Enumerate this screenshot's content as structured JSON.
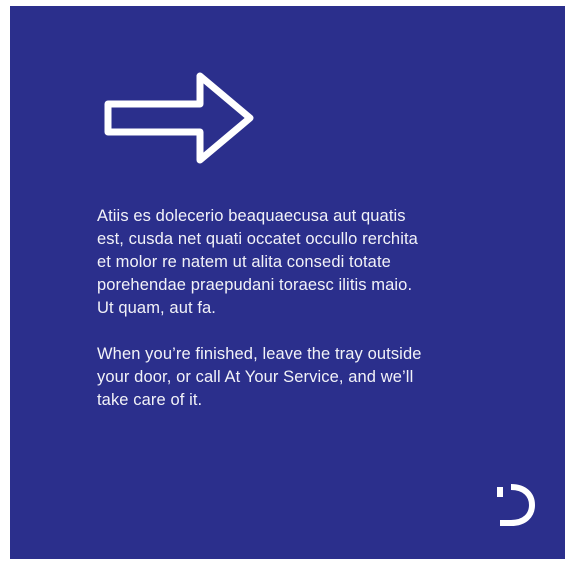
{
  "card": {
    "background_color": "#2b2f8c",
    "text_color": "#f2f2f8",
    "icon": "arrow-right-icon",
    "paragraphs": [
      "Atiis es dolecerio beaquaecusa aut quatis\nest, cusda net quati occatet occullo rerchita\net molor re natem ut alita consedi totate\nporehendae praepudani toraesc ilitis maio.\nUt quam, aut fa.",
      "When you’re finished, leave the tray outside\nyour door, or call At Your Service, and we’ll\ntake care of it."
    ],
    "logo": "d-logo"
  }
}
